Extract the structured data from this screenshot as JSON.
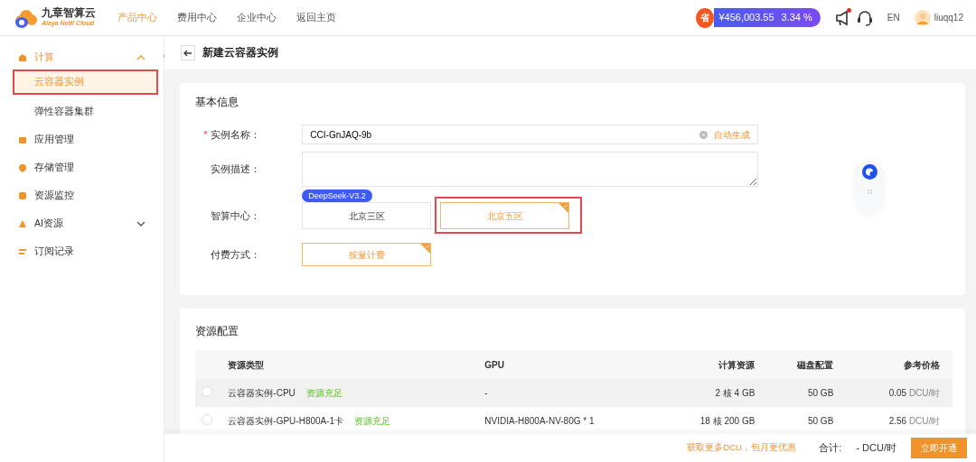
{
  "header": {
    "logo": {
      "name": "九章智算云",
      "tagline": "Alaya NeW Cloud"
    },
    "nav": [
      {
        "label": "产品中心",
        "selected": true
      },
      {
        "label": "费用中心",
        "selected": false
      },
      {
        "label": "企业中心",
        "selected": false
      },
      {
        "label": "返回主页",
        "selected": false
      }
    ],
    "balance": {
      "badge": "省",
      "amount": "¥456,003.55",
      "rate": "3.34 %"
    },
    "notifications": {
      "unread": true
    },
    "language": "EN",
    "user": "liuqq12"
  },
  "sidebar": {
    "items": [
      {
        "label": "计算",
        "expanded": true,
        "children": [
          {
            "label": "云容器实例",
            "selected": true,
            "highlighted": true
          },
          {
            "label": "弹性容器集群",
            "selected": false,
            "highlighted": false
          }
        ]
      },
      {
        "label": "应用管理"
      },
      {
        "label": "存储管理"
      },
      {
        "label": "资源监控"
      },
      {
        "label": "AI资源",
        "expanded": false
      },
      {
        "label": "订阅记录"
      }
    ]
  },
  "page": {
    "title": "新建云容器实例"
  },
  "basic_info": {
    "title": "基本信息",
    "fields": [
      {
        "kind": "text",
        "label": "实例名称：",
        "required_mark": "*",
        "value": "CCI-GnJAQ-9b",
        "action": "自动生成"
      },
      {
        "kind": "textarea",
        "label": "实例描述："
      },
      {
        "kind": "options",
        "label": "智算中心：",
        "options": [
          {
            "label": "北京三区",
            "selected": false,
            "tag": "DeepSeek-V3.2",
            "highlighted": false
          },
          {
            "label": "北京五区",
            "selected": true,
            "highlighted": true
          }
        ]
      },
      {
        "kind": "options",
        "label": "付费方式：",
        "options": [
          {
            "label": "按量计费",
            "selected": true,
            "highlighted": false
          }
        ]
      }
    ]
  },
  "resources": {
    "title": "资源配置",
    "table": {
      "columns": [
        "资源类型",
        "GPU",
        "计算资源",
        "磁盘配置",
        "参考价格"
      ],
      "rows": [
        {
          "selected": false,
          "hovered": true,
          "type": "云容器实例-CPU",
          "availability": "资源充足",
          "gpu": "-",
          "compute": "2 核 4 GB",
          "disk": "50 GB",
          "price": "0.05",
          "unit": "DCU/时"
        },
        {
          "selected": false,
          "hovered": false,
          "type": "云容器实例-GPU-H800A-1卡",
          "availability": "资源充足",
          "gpu": "NVIDIA-H800A-NV-80G * 1",
          "compute": "18 核 200 GB",
          "disk": "50 GB",
          "price": "2.56",
          "unit": "DCU/时"
        }
      ]
    }
  },
  "footer": {
    "promo": "获取更多DCU，包月更优惠",
    "total_label": "合计:",
    "total_value": "-",
    "total_unit": "DCU/时",
    "submit": "立即开通"
  }
}
